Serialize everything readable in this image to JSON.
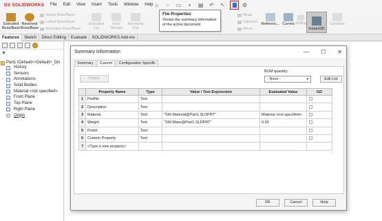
{
  "app": {
    "logo_ds": "DS",
    "logo_name": "SOLIDWORKS"
  },
  "menus": [
    "File",
    "Edit",
    "View",
    "Insert",
    "Tools",
    "Window",
    "Help"
  ],
  "tooltip": {
    "title": "File Properties",
    "desc_line1": "Shows the summary information",
    "desc_line2": "of the active document"
  },
  "ribbon": {
    "extruded": "Extruded\nBoss/Base",
    "revolved": "Revolved\nBoss/Base",
    "swept": "Swept Boss/Base",
    "lofted": "Lofted Boss/Base",
    "boundary": "Boundary Boss/Base",
    "extruded_cut": "Extruded\nCut",
    "hole_wizard": "Hole Wizard",
    "revolved_cut": "Revolved\nCut",
    "wrap": "Wrap",
    "intersect": "Intersect",
    "mirror": "Mirror",
    "reference": "Referenc...",
    "curves": "Curves",
    "instant3d": "Instant3D",
    "combine": "Combine",
    "sliding": "Sliding"
  },
  "cm_tabs": [
    "Features",
    "Sketch",
    "Direct Editing",
    "Evaluate",
    "SOLIDWORKS Add-Ins"
  ],
  "tree": {
    "part": "Part1 (Default<<Default>_Dis",
    "items": [
      "History",
      "Sensors",
      "Annotations",
      "Solid Bodies",
      "Material <not specified>",
      "Front Plane",
      "Top Plane",
      "Right Plane",
      "Origin"
    ]
  },
  "dialog": {
    "title": "Summary Information",
    "tabs": [
      "Summary",
      "Custom",
      "Configuration Specific"
    ],
    "delete_label": "Delete",
    "bom_label": "BOM quantity:",
    "bom_value": "- None -",
    "edit_list_label": "Edit List",
    "headers": [
      "Property Name",
      "Type",
      "Value / Text Expression",
      "Evaluated Value",
      "GD"
    ],
    "rows": [
      {
        "n": "1",
        "name": "PartNo",
        "type": "Text",
        "value": "",
        "evaluated": ""
      },
      {
        "n": "2",
        "name": "Description",
        "type": "Text",
        "value": "",
        "evaluated": ""
      },
      {
        "n": "3",
        "name": "Material",
        "type": "Text",
        "value": "\"SW-Material@Part1.SLDPRT\"",
        "evaluated": "Material <not specified>"
      },
      {
        "n": "4",
        "name": "Weight",
        "type": "Text",
        "value": "\"SW-Mass@Part1.SLDPRT\"",
        "evaluated": "0.00"
      },
      {
        "n": "5",
        "name": "Finish",
        "type": "Text",
        "value": "",
        "evaluated": ""
      },
      {
        "n": "6",
        "name": "Custom Property",
        "type": "Text",
        "value": "",
        "evaluated": ""
      },
      {
        "n": "7",
        "name": "<Type a new property>",
        "type": "",
        "value": "",
        "evaluated": ""
      }
    ],
    "ok_label": "OK",
    "cancel_label": "Cancel",
    "help_label": "Help"
  }
}
